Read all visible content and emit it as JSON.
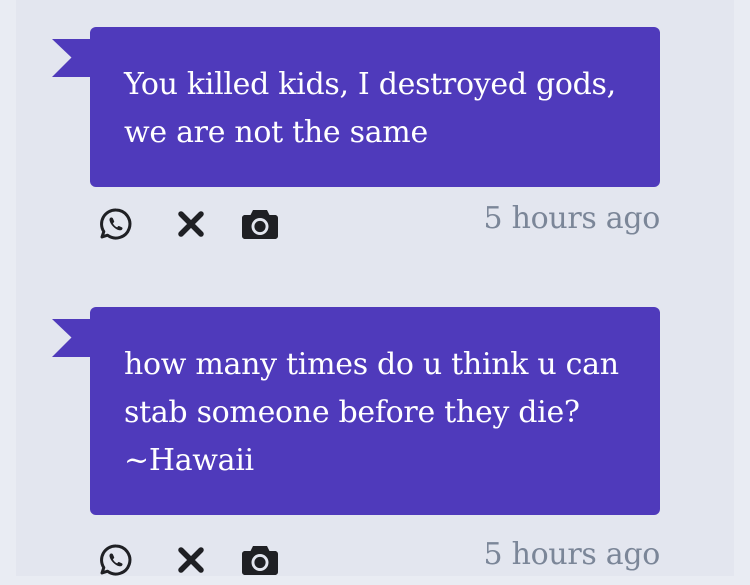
{
  "posts": [
    {
      "message": "You killed kids, I destroyed gods,\nwe are not the same",
      "timestamp": "5 hours ago",
      "actions": [
        "whatsapp-icon",
        "close-icon",
        "camera-icon"
      ]
    },
    {
      "message": "how many times do u think u can\nstab someone before they die?\n~Hawaii",
      "timestamp": "5 hours ago",
      "actions": [
        "whatsapp-icon",
        "close-icon",
        "camera-icon"
      ]
    }
  ],
  "colors": {
    "bubble": "#4f3abb",
    "feed_background": "#e3e6ef",
    "timestamp": "#7b8698",
    "icon": "#1f2024"
  }
}
